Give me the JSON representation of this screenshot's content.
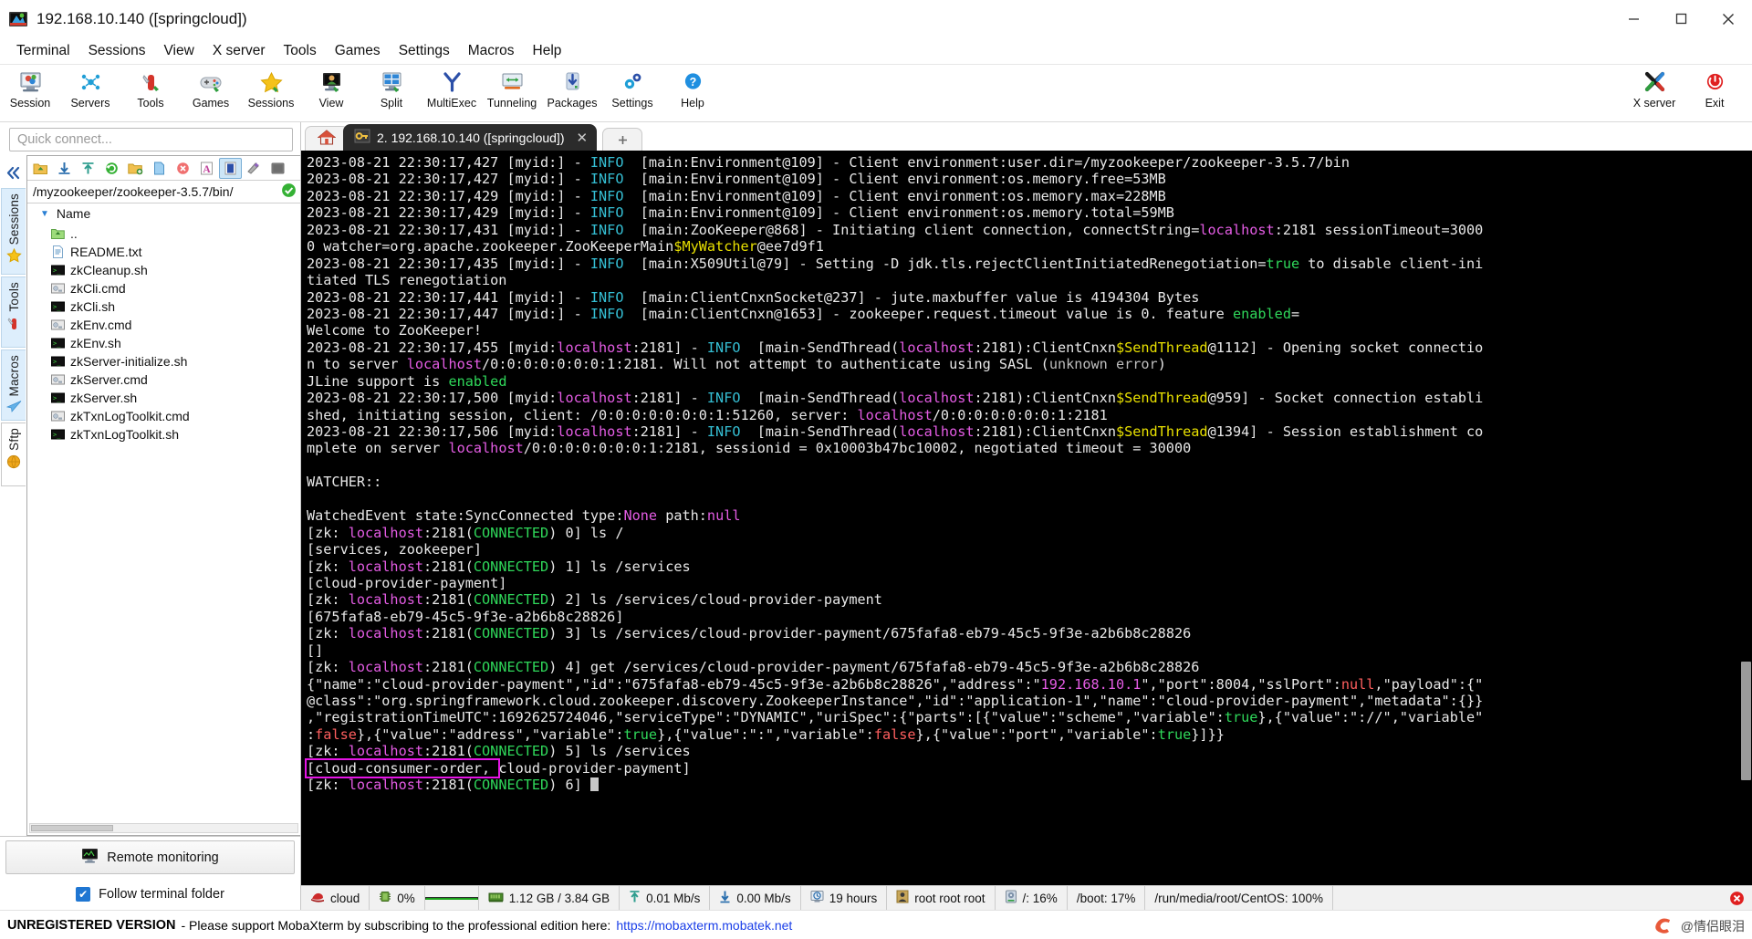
{
  "window": {
    "title": "192.168.10.140 ([springcloud])",
    "app_icon": "mobaxterm-icon",
    "minimize": "minimize-icon",
    "maximize": "maximize-icon",
    "close": "close-icon"
  },
  "menubar": [
    "Terminal",
    "Sessions",
    "View",
    "X server",
    "Tools",
    "Games",
    "Settings",
    "Macros",
    "Help"
  ],
  "toolbar": {
    "left_items": [
      {
        "label": "Session",
        "icon": "session-icon"
      },
      {
        "label": "Servers",
        "icon": "servers-icon"
      },
      {
        "label": "Tools",
        "icon": "tools-icon"
      },
      {
        "label": "Games",
        "icon": "games-icon"
      },
      {
        "label": "Sessions",
        "icon": "sessions-star-icon"
      },
      {
        "label": "View",
        "icon": "view-icon"
      },
      {
        "label": "Split",
        "icon": "split-icon"
      },
      {
        "label": "MultiExec",
        "icon": "multiexec-icon"
      },
      {
        "label": "Tunneling",
        "icon": "tunneling-icon"
      },
      {
        "label": "Packages",
        "icon": "packages-icon"
      },
      {
        "label": "Settings",
        "icon": "settings-gear-icon"
      },
      {
        "label": "Help",
        "icon": "help-icon"
      }
    ],
    "right_items": [
      {
        "label": "X server",
        "icon": "xserver-icon"
      },
      {
        "label": "Exit",
        "icon": "exit-power-icon"
      }
    ]
  },
  "sidebar": {
    "quick_connect_placeholder": "Quick connect...",
    "collapse_icon": "chevron-double-left-icon",
    "tabs": [
      {
        "label": "Sessions",
        "icon": "star-icon"
      },
      {
        "label": "Tools",
        "icon": "swiss-knife-icon"
      },
      {
        "label": "Macros",
        "icon": "paper-plane-icon"
      },
      {
        "label": "Sftp",
        "icon": "globe-icon"
      }
    ]
  },
  "browser": {
    "toolbar_buttons": [
      "up-folder-icon",
      "download-icon",
      "upload-icon",
      "refresh-icon",
      "new-folder-icon",
      "new-file-icon",
      "delete-icon",
      "text-mode-icon",
      "binary-mode-icon",
      "permissions-icon",
      "terminal-icon"
    ],
    "active_button_index": 8,
    "path": "/myzookeeper/zookeeper-3.5.7/bin/",
    "path_status_icon": "check-ok-icon",
    "column_header": "Name",
    "files": [
      {
        "name": "..",
        "icon": "parent-folder-icon"
      },
      {
        "name": "README.txt",
        "icon": "text-file-icon"
      },
      {
        "name": "zkCleanup.sh",
        "icon": "shell-file-icon"
      },
      {
        "name": "zkCli.cmd",
        "icon": "cmd-file-icon"
      },
      {
        "name": "zkCli.sh",
        "icon": "shell-file-icon"
      },
      {
        "name": "zkEnv.cmd",
        "icon": "cmd-file-icon"
      },
      {
        "name": "zkEnv.sh",
        "icon": "shell-file-icon"
      },
      {
        "name": "zkServer-initialize.sh",
        "icon": "shell-file-icon"
      },
      {
        "name": "zkServer.cmd",
        "icon": "cmd-file-icon"
      },
      {
        "name": "zkServer.sh",
        "icon": "shell-file-icon"
      },
      {
        "name": "zkTxnLogToolkit.cmd",
        "icon": "cmd-file-icon"
      },
      {
        "name": "zkTxnLogToolkit.sh",
        "icon": "shell-file-icon"
      }
    ],
    "remote_monitoring_label": "Remote monitoring",
    "remote_monitoring_icon": "monitor-icon",
    "follow_terminal_folder_label": "Follow terminal folder",
    "follow_terminal_folder_checked": true
  },
  "tabs": {
    "home_icon": "home-icon",
    "active": {
      "icon": "key-icon",
      "label": "2. 192.168.10.140 ([springcloud])",
      "close_icon": "close-icon"
    },
    "new_tab_icon": "new-tab-icon"
  },
  "terminal": {
    "lines": [
      [
        [
          "2023-08-21 22:30:17,427 [myid:] - ",
          "white"
        ],
        [
          "INFO",
          "cyan"
        ],
        [
          "  [main:Environment@109] - Client environment:user.dir=/myzookeeper/zookeeper-3.5.7/bin",
          "white"
        ]
      ],
      [
        [
          "2023-08-21 22:30:17,427 [myid:] - ",
          "white"
        ],
        [
          "INFO",
          "cyan"
        ],
        [
          "  [main:Environment@109] - Client environment:os.memory.free=53MB",
          "white"
        ]
      ],
      [
        [
          "2023-08-21 22:30:17,429 [myid:] - ",
          "white"
        ],
        [
          "INFO",
          "cyan"
        ],
        [
          "  [main:Environment@109] - Client environment:os.memory.max=228MB",
          "white"
        ]
      ],
      [
        [
          "2023-08-21 22:30:17,429 [myid:] - ",
          "white"
        ],
        [
          "INFO",
          "cyan"
        ],
        [
          "  [main:Environment@109] - Client environment:os.memory.total=59MB",
          "white"
        ]
      ],
      [
        [
          "2023-08-21 22:30:17,431 [myid:] - ",
          "white"
        ],
        [
          "INFO",
          "cyan"
        ],
        [
          "  [main:ZooKeeper@868] - Initiating client connection, connectString=",
          "white"
        ],
        [
          "localhost",
          "magenta"
        ],
        [
          ":2181 sessionTimeout=3000",
          "white"
        ]
      ],
      [
        [
          "0 watcher=org.apache.zookeeper.ZooKeeperMain",
          "white"
        ],
        [
          "$MyWatcher",
          "yellow"
        ],
        [
          "@ee7d9f1",
          "white"
        ]
      ],
      [
        [
          "2023-08-21 22:30:17,435 [myid:] - ",
          "white"
        ],
        [
          "INFO",
          "cyan"
        ],
        [
          "  [main:X509Util@79] - Setting -D jdk.tls.rejectClientInitiatedRenegotiation=",
          "white"
        ],
        [
          "true",
          "green"
        ],
        [
          " to disable client-ini",
          "white"
        ]
      ],
      [
        [
          "tiated TLS renegotiation",
          "white"
        ]
      ],
      [
        [
          "2023-08-21 22:30:17,441 [myid:] - ",
          "white"
        ],
        [
          "INFO",
          "cyan"
        ],
        [
          "  [main:ClientCnxnSocket@237] - jute.maxbuffer value is 4194304 Bytes",
          "white"
        ]
      ],
      [
        [
          "2023-08-21 22:30:17,447 [myid:] - ",
          "white"
        ],
        [
          "INFO",
          "cyan"
        ],
        [
          "  [main:ClientCnxn@1653] - zookeeper.request.timeout value is 0. feature ",
          "white"
        ],
        [
          "enabled",
          "green"
        ],
        [
          "=",
          "white"
        ]
      ],
      [
        [
          "Welcome to ZooKeeper!",
          "white"
        ]
      ],
      [
        [
          "2023-08-21 22:30:17,455 [myid:",
          "white"
        ],
        [
          "localhost",
          "magenta"
        ],
        [
          ":2181] - ",
          "white"
        ],
        [
          "INFO",
          "cyan"
        ],
        [
          "  [main-SendThread(",
          "white"
        ],
        [
          "localhost",
          "magenta"
        ],
        [
          ":2181):ClientCnxn",
          "white"
        ],
        [
          "$SendThread",
          "yellow"
        ],
        [
          "@1112] - Opening socket connectio",
          "white"
        ]
      ],
      [
        [
          "n to server ",
          "white"
        ],
        [
          "localhost",
          "magenta"
        ],
        [
          "/0:0:0:0:0:0:0:1:2181. Will not attempt to authenticate using SASL (",
          "white"
        ],
        [
          "unknown error",
          "grey"
        ],
        [
          ")",
          "white"
        ]
      ],
      [
        [
          "JLine support is ",
          "white"
        ],
        [
          "enabled",
          "green"
        ]
      ],
      [
        [
          "2023-08-21 22:30:17,500 [myid:",
          "white"
        ],
        [
          "localhost",
          "magenta"
        ],
        [
          ":2181] - ",
          "white"
        ],
        [
          "INFO",
          "cyan"
        ],
        [
          "  [main-SendThread(",
          "white"
        ],
        [
          "localhost",
          "magenta"
        ],
        [
          ":2181):ClientCnxn",
          "white"
        ],
        [
          "$SendThread",
          "yellow"
        ],
        [
          "@959] - Socket connection establi",
          "white"
        ]
      ],
      [
        [
          "shed, initiating session, client: /0:0:0:0:0:0:0:1:51260, server: ",
          "white"
        ],
        [
          "localhost",
          "magenta"
        ],
        [
          "/0:0:0:0:0:0:0:1:2181",
          "white"
        ]
      ],
      [
        [
          "2023-08-21 22:30:17,506 [myid:",
          "white"
        ],
        [
          "localhost",
          "magenta"
        ],
        [
          ":2181] - ",
          "white"
        ],
        [
          "INFO",
          "cyan"
        ],
        [
          "  [main-SendThread(",
          "white"
        ],
        [
          "localhost",
          "magenta"
        ],
        [
          ":2181):ClientCnxn",
          "white"
        ],
        [
          "$SendThread",
          "yellow"
        ],
        [
          "@1394] - Session establishment co",
          "white"
        ]
      ],
      [
        [
          "mplete on server ",
          "white"
        ],
        [
          "localhost",
          "magenta"
        ],
        [
          "/0:0:0:0:0:0:0:1:2181, sessionid = 0x10003b47bc10002, negotiated timeout = 30000",
          "white"
        ]
      ],
      [
        [
          "",
          ""
        ]
      ],
      [
        [
          "WATCHER::",
          "white"
        ]
      ],
      [
        [
          "",
          ""
        ]
      ],
      [
        [
          "WatchedEvent state:SyncConnected type:",
          "white"
        ],
        [
          "None",
          "magenta"
        ],
        [
          " path:",
          "white"
        ],
        [
          "null",
          "magenta"
        ]
      ],
      [
        [
          "[zk: ",
          "white"
        ],
        [
          "localhost",
          "magenta"
        ],
        [
          ":2181(",
          "white"
        ],
        [
          "CONNECTED",
          "green"
        ],
        [
          ") 0] ls /",
          "white"
        ]
      ],
      [
        [
          "[services, zookeeper]",
          "white"
        ]
      ],
      [
        [
          "[zk: ",
          "white"
        ],
        [
          "localhost",
          "magenta"
        ],
        [
          ":2181(",
          "white"
        ],
        [
          "CONNECTED",
          "green"
        ],
        [
          ") 1] ls /services",
          "white"
        ]
      ],
      [
        [
          "[cloud-provider-payment]",
          "white"
        ]
      ],
      [
        [
          "[zk: ",
          "white"
        ],
        [
          "localhost",
          "magenta"
        ],
        [
          ":2181(",
          "white"
        ],
        [
          "CONNECTED",
          "green"
        ],
        [
          ") 2] ls /services/cloud-provider-payment",
          "white"
        ]
      ],
      [
        [
          "[675fafa8-eb79-45c5-9f3e-a2b6b8c28826]",
          "white"
        ]
      ],
      [
        [
          "[zk: ",
          "white"
        ],
        [
          "localhost",
          "magenta"
        ],
        [
          ":2181(",
          "white"
        ],
        [
          "CONNECTED",
          "green"
        ],
        [
          ") 3] ls /services/cloud-provider-payment/675fafa8-eb79-45c5-9f3e-a2b6b8c28826",
          "white"
        ]
      ],
      [
        [
          "[]",
          "white"
        ]
      ],
      [
        [
          "[zk: ",
          "white"
        ],
        [
          "localhost",
          "magenta"
        ],
        [
          ":2181(",
          "white"
        ],
        [
          "CONNECTED",
          "green"
        ],
        [
          ") 4] get /services/cloud-provider-payment/675fafa8-eb79-45c5-9f3e-a2b6b8c28826",
          "white"
        ]
      ],
      [
        [
          "{\"name\":\"cloud-provider-payment\",\"id\":\"675fafa8-eb79-45c5-9f3e-a2b6b8c28826\",\"address\":\"",
          "white"
        ],
        [
          "192.168.10.1",
          "magenta"
        ],
        [
          "\",\"port\":8004,\"sslPort\":",
          "white"
        ],
        [
          "null",
          "red"
        ],
        [
          ",\"payload\":{\"",
          "white"
        ]
      ],
      [
        [
          "@class\":\"org.springframework.cloud.zookeeper.discovery.ZookeeperInstance\",\"id\":\"application-1\",\"name\":\"cloud-provider-payment\",\"metadata\":{}}",
          "white"
        ]
      ],
      [
        [
          ",\"registrationTimeUTC\":1692625724046,\"serviceType\":\"DYNAMIC\",\"uriSpec\":{\"parts\":[{\"value\":\"scheme\",\"variable\":",
          "white"
        ],
        [
          "true",
          "green"
        ],
        [
          "},{\"value\":\"://\",\"variable\"",
          "white"
        ]
      ],
      [
        [
          ":",
          "white"
        ],
        [
          "false",
          "red"
        ],
        [
          "},{\"value\":\"address\",\"variable\":",
          "white"
        ],
        [
          "true",
          "green"
        ],
        [
          "},{\"value\":\":\",\"variable\":",
          "white"
        ],
        [
          "false",
          "red"
        ],
        [
          "},{\"value\":\"port\",\"variable\":",
          "white"
        ],
        [
          "true",
          "green"
        ],
        [
          "}]}}",
          "white"
        ]
      ],
      [
        [
          "[zk: ",
          "white"
        ],
        [
          "localhost",
          "magenta"
        ],
        [
          ":2181(",
          "white"
        ],
        [
          "CONNECTED",
          "green"
        ],
        [
          ") 5] ls /services",
          "white"
        ]
      ],
      [
        [
          "[cloud-consumer-order, ",
          "white",
          "boxed"
        ],
        [
          "cloud-provider-payment]",
          "white"
        ]
      ],
      [
        [
          "[zk: ",
          "white"
        ],
        [
          "localhost",
          "magenta"
        ],
        [
          ":2181(",
          "white"
        ],
        [
          "CONNECTED",
          "green"
        ],
        [
          ") 6] ",
          "white"
        ],
        [
          "CURSOR",
          "cursor"
        ]
      ]
    ]
  },
  "statusbar": {
    "cells": [
      {
        "icon": "hat-icon",
        "text": "cloud"
      },
      {
        "icon": "cpu-icon",
        "text": "0%"
      },
      {
        "icon": "graph",
        "text": ""
      },
      {
        "icon": "ram-icon",
        "text": "1.12 GB / 3.84 GB"
      },
      {
        "icon": "upload-arrow-icon",
        "text": "0.01 Mb/s"
      },
      {
        "icon": "download-arrow-icon",
        "text": "0.00 Mb/s"
      },
      {
        "icon": "uptime-icon",
        "text": "19 hours"
      },
      {
        "icon": "users-icon",
        "text": "root  root  root"
      },
      {
        "icon": "disk-icon",
        "text": "/: 16%"
      },
      {
        "icon": "",
        "text": "/boot: 17%"
      },
      {
        "icon": "",
        "text": "/run/media/root/CentOS: 100%"
      }
    ],
    "close_icon": "close-circle-icon"
  },
  "footer": {
    "unregistered": "UNREGISTERED VERSION",
    "message": "-  Please support MobaXterm by subscribing to the professional edition here:",
    "link": "https://mobaxterm.mobatek.net",
    "watermark": "@情侣眼泪"
  },
  "colors": {
    "accent": "#1f76d2",
    "terminal_bg": "#000000",
    "highlight_box": "#e515e5",
    "link": "#1a3ee8"
  }
}
